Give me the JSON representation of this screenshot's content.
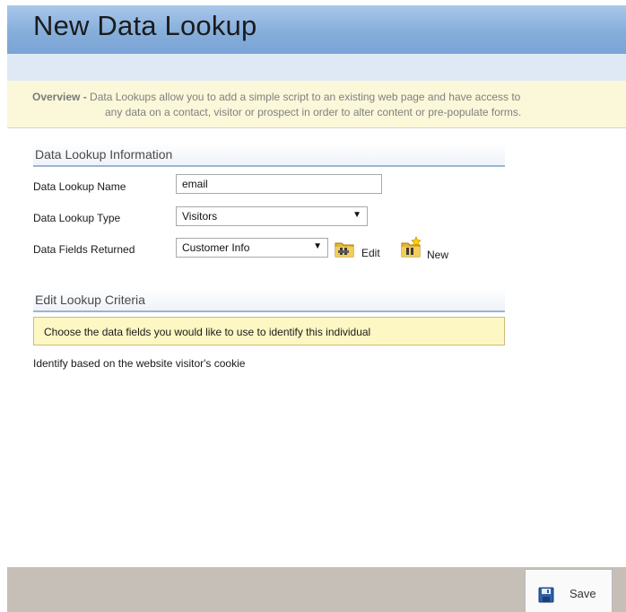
{
  "header": {
    "title": "New Data Lookup"
  },
  "overview": {
    "label": "Overview -",
    "line1": "Data Lookups allow you to add a simple script to an existing web page and have access to",
    "line2": "any data on a contact, visitor or prospect in order to alter content or pre-populate forms."
  },
  "info_section": {
    "heading": "Data Lookup Information",
    "name_label": "Data Lookup Name",
    "name_value": "email",
    "type_label": "Data Lookup Type",
    "type_value": "Visitors",
    "fields_label": "Data Fields Returned",
    "fields_value": "Customer Info",
    "edit_label": "Edit",
    "new_label": "New"
  },
  "criteria_section": {
    "heading": "Edit Lookup Criteria",
    "instruction": "Choose the data fields you would like to use to identify this individual",
    "identify_text": "Identify based on the website visitor's cookie"
  },
  "footer": {
    "save_label": "Save"
  },
  "colors": {
    "title_bar": "#86aedb",
    "sub_bar": "#dfe9f6",
    "overview_bg": "#fbf7d9",
    "criteria_bg": "#fdf7c4",
    "footer_bg": "#c5bfb7"
  }
}
